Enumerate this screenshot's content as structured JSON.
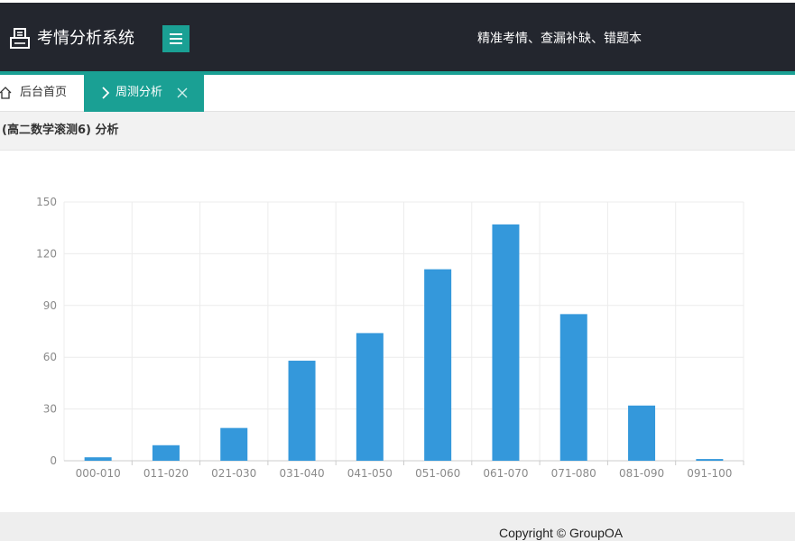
{
  "header": {
    "app_title": "考情分析系统",
    "slogan": "精准考情、查漏补缺、错题本",
    "icons": {
      "logo": "printer-icon",
      "menu": "hamburger-menu-icon"
    },
    "colors": {
      "background": "#23262e",
      "accent": "#1aa094"
    }
  },
  "tabs": {
    "home_label": "后台首页",
    "active_label": "周测分析",
    "icons": {
      "home": "home-icon",
      "active": "chevron-right-icon",
      "close": "close-icon"
    }
  },
  "panel": {
    "title": "(高二数学滚测6) 分析"
  },
  "chart_data": {
    "type": "bar",
    "categories": [
      "000-010",
      "011-020",
      "021-030",
      "031-040",
      "041-050",
      "051-060",
      "061-070",
      "071-080",
      "081-090",
      "091-100"
    ],
    "values": [
      2,
      9,
      19,
      58,
      74,
      111,
      137,
      85,
      32,
      1
    ],
    "yticks": [
      "0",
      "30",
      "60",
      "90",
      "120",
      "150"
    ],
    "ylim": [
      0,
      150
    ],
    "grid": true,
    "bar_color": "#3498db"
  },
  "footer": {
    "copyright": "Copyright © GroupOA"
  }
}
